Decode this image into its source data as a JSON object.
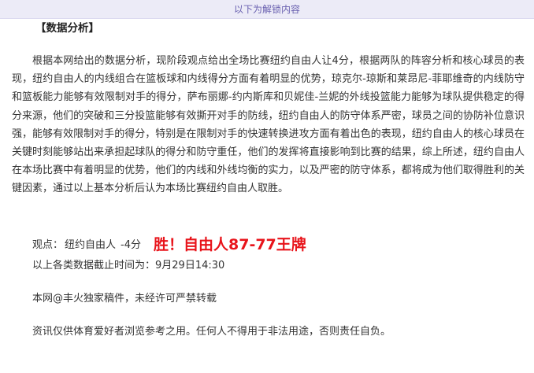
{
  "banner": {
    "text": "以下为解锁内容"
  },
  "article": {
    "heading": "【数据分析】",
    "paragraph": "根据本网给出的数据分析，现阶段观点给出全场比赛纽约自由人让4分，根据两队的阵容分析和核心球员的表现，纽约自由人的内线组合在篮板球和内线得分方面有着明显的优势，琼克尔-琼斯和莱昂尼-菲耶维奇的内线防守和篮板能力能够有效限制对手的得分，萨布丽娜-约内斯库和贝妮佳-兰妮的外线投篮能力能够为球队提供稳定的得分来源，他们的突破和三分投篮能够有效撕开对手的防线，纽约自由人的防守体系严密，球员之间的协防补位意识强，能够有效限制对手的得分，特别是在限制对手的快速转换进攻方面有着出色的表现，纽约自由人的核心球员在关键时刻能够站出来承担起球队的得分和防守重任，他们的发挥将直接影响到比赛的结果，综上所述，纽约自由人在本场比赛中有着明显的优势，他们的内线和外线均衡的实力，以及严密的防守体系，都将成为他们取得胜利的关键因素，通过以上基本分析后认为本场比赛纽约自由人取胜。",
    "view": {
      "label": "观点：",
      "pick": "纽约自由人",
      "line": "-4分",
      "result": "胜！自由人87-77王牌"
    },
    "cutoff": "以上各类数据截止时间为：9月29日14:30",
    "copyright": "本网@丰火独家稿件，未经许可严禁转载",
    "disclaimer": "资讯仅供体育爱好者浏览参考之用。任何人不得用于非法用途，否则责任自负。"
  },
  "colors": {
    "banner_bg": "#ecebf7",
    "banner_text": "#6a61b0",
    "result_red": "#e8141b",
    "body_text": "#333333"
  }
}
